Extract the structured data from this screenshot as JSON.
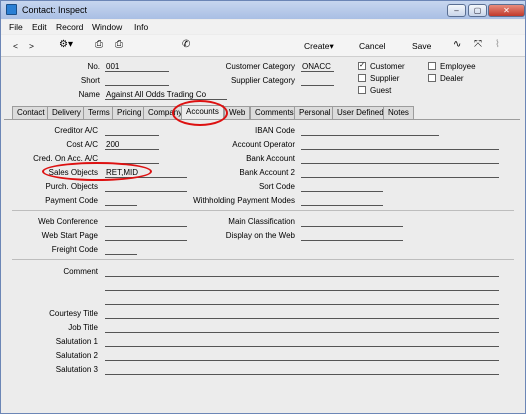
{
  "window": {
    "title": "Contact: Inspect",
    "buttons": [
      "–",
      "▢",
      "✕"
    ]
  },
  "menu": [
    "File",
    "Edit",
    "Record",
    "Window",
    "Info"
  ],
  "toolbar": {
    "back": "<",
    "forward": ">",
    "create": "Create▾",
    "cancel": "Cancel",
    "save": "Save"
  },
  "header": {
    "no_label": "No.",
    "no_value": "001",
    "short_label": "Short",
    "short_value": "",
    "name_label": "Name",
    "name_value": "Against All Odds Trading Co",
    "cust_cat_label": "Customer Category",
    "cust_cat_value": "ONACC",
    "supp_cat_label": "Supplier Category",
    "supp_cat_value": "",
    "checks": {
      "customer": {
        "label": "Customer",
        "checked": true,
        "mark": "✓"
      },
      "supplier": {
        "label": "Supplier",
        "checked": false
      },
      "guest": {
        "label": "Guest",
        "checked": false
      },
      "employee": {
        "label": "Employee",
        "checked": false
      },
      "dealer": {
        "label": "Dealer",
        "checked": false
      }
    }
  },
  "tabs": [
    "Contact",
    "Delivery",
    "Terms",
    "Pricing",
    "Company",
    "Accounts",
    "Web",
    "Comments",
    "Personal",
    "User Defined",
    "Notes"
  ],
  "active_tab": "Accounts",
  "accounts": {
    "creditor_ac": {
      "label": "Creditor A/C",
      "value": ""
    },
    "cost_ac": {
      "label": "Cost A/C",
      "value": "200"
    },
    "cred_on_acc": {
      "label": "Cred. On Acc. A/C",
      "value": ""
    },
    "sales_objects": {
      "label": "Sales Objects",
      "value": "RET,MID"
    },
    "purch_objects": {
      "label": "Purch. Objects",
      "value": ""
    },
    "payment_code": {
      "label": "Payment Code",
      "value": ""
    },
    "iban_code": {
      "label": "IBAN Code",
      "value": ""
    },
    "account_operator": {
      "label": "Account Operator",
      "value": ""
    },
    "bank_account": {
      "label": "Bank Account",
      "value": ""
    },
    "bank_account_2": {
      "label": "Bank Account 2",
      "value": ""
    },
    "sort_code": {
      "label": "Sort Code",
      "value": ""
    },
    "withholding": {
      "label": "Withholding Payment Modes",
      "value": ""
    },
    "web_conference": {
      "label": "Web Conference",
      "value": ""
    },
    "web_start_page": {
      "label": "Web Start Page",
      "value": ""
    },
    "freight_code": {
      "label": "Freight Code",
      "value": ""
    },
    "main_classification": {
      "label": "Main Classification",
      "value": ""
    },
    "display_on_web": {
      "label": "Display on the Web",
      "value": ""
    },
    "comment": {
      "label": "Comment",
      "value": ""
    },
    "courtesy_title": {
      "label": "Courtesy Title",
      "value": ""
    },
    "job_title": {
      "label": "Job Title",
      "value": ""
    },
    "salutation_1": {
      "label": "Salutation 1",
      "value": ""
    },
    "salutation_2": {
      "label": "Salutation 2",
      "value": ""
    },
    "salutation_3": {
      "label": "Salutation 3",
      "value": ""
    }
  },
  "colors": {
    "highlight_oval": "#dd1111",
    "title_bar": "#b8cbea"
  }
}
